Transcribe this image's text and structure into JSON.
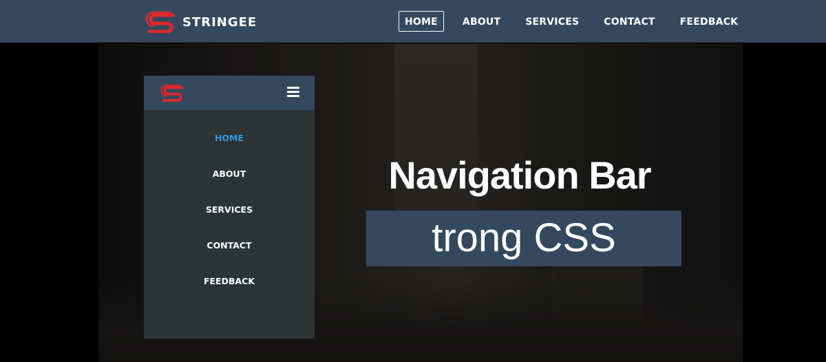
{
  "brand": {
    "name": "STRINGEE",
    "logo_icon": "stringee-logo-icon",
    "logo_color": "#e0282e"
  },
  "topnav": {
    "items": [
      {
        "label": "HOME",
        "active": true
      },
      {
        "label": "ABOUT",
        "active": false
      },
      {
        "label": "SERVICES",
        "active": false
      },
      {
        "label": "CONTACT",
        "active": false
      },
      {
        "label": "FEEDBACK",
        "active": false
      }
    ]
  },
  "mobile": {
    "menu_icon": "hamburger-menu-icon",
    "items": [
      {
        "label": "HOME",
        "active": true
      },
      {
        "label": "ABOUT",
        "active": false
      },
      {
        "label": "SERVICES",
        "active": false
      },
      {
        "label": "CONTACT",
        "active": false
      },
      {
        "label": "FEEDBACK",
        "active": false
      }
    ]
  },
  "hero": {
    "title": "Navigation Bar",
    "subtitle": "trong CSS"
  },
  "colors": {
    "navbar": "#34495e",
    "mobile_body": "#2d3436",
    "active_link": "#3498db"
  }
}
